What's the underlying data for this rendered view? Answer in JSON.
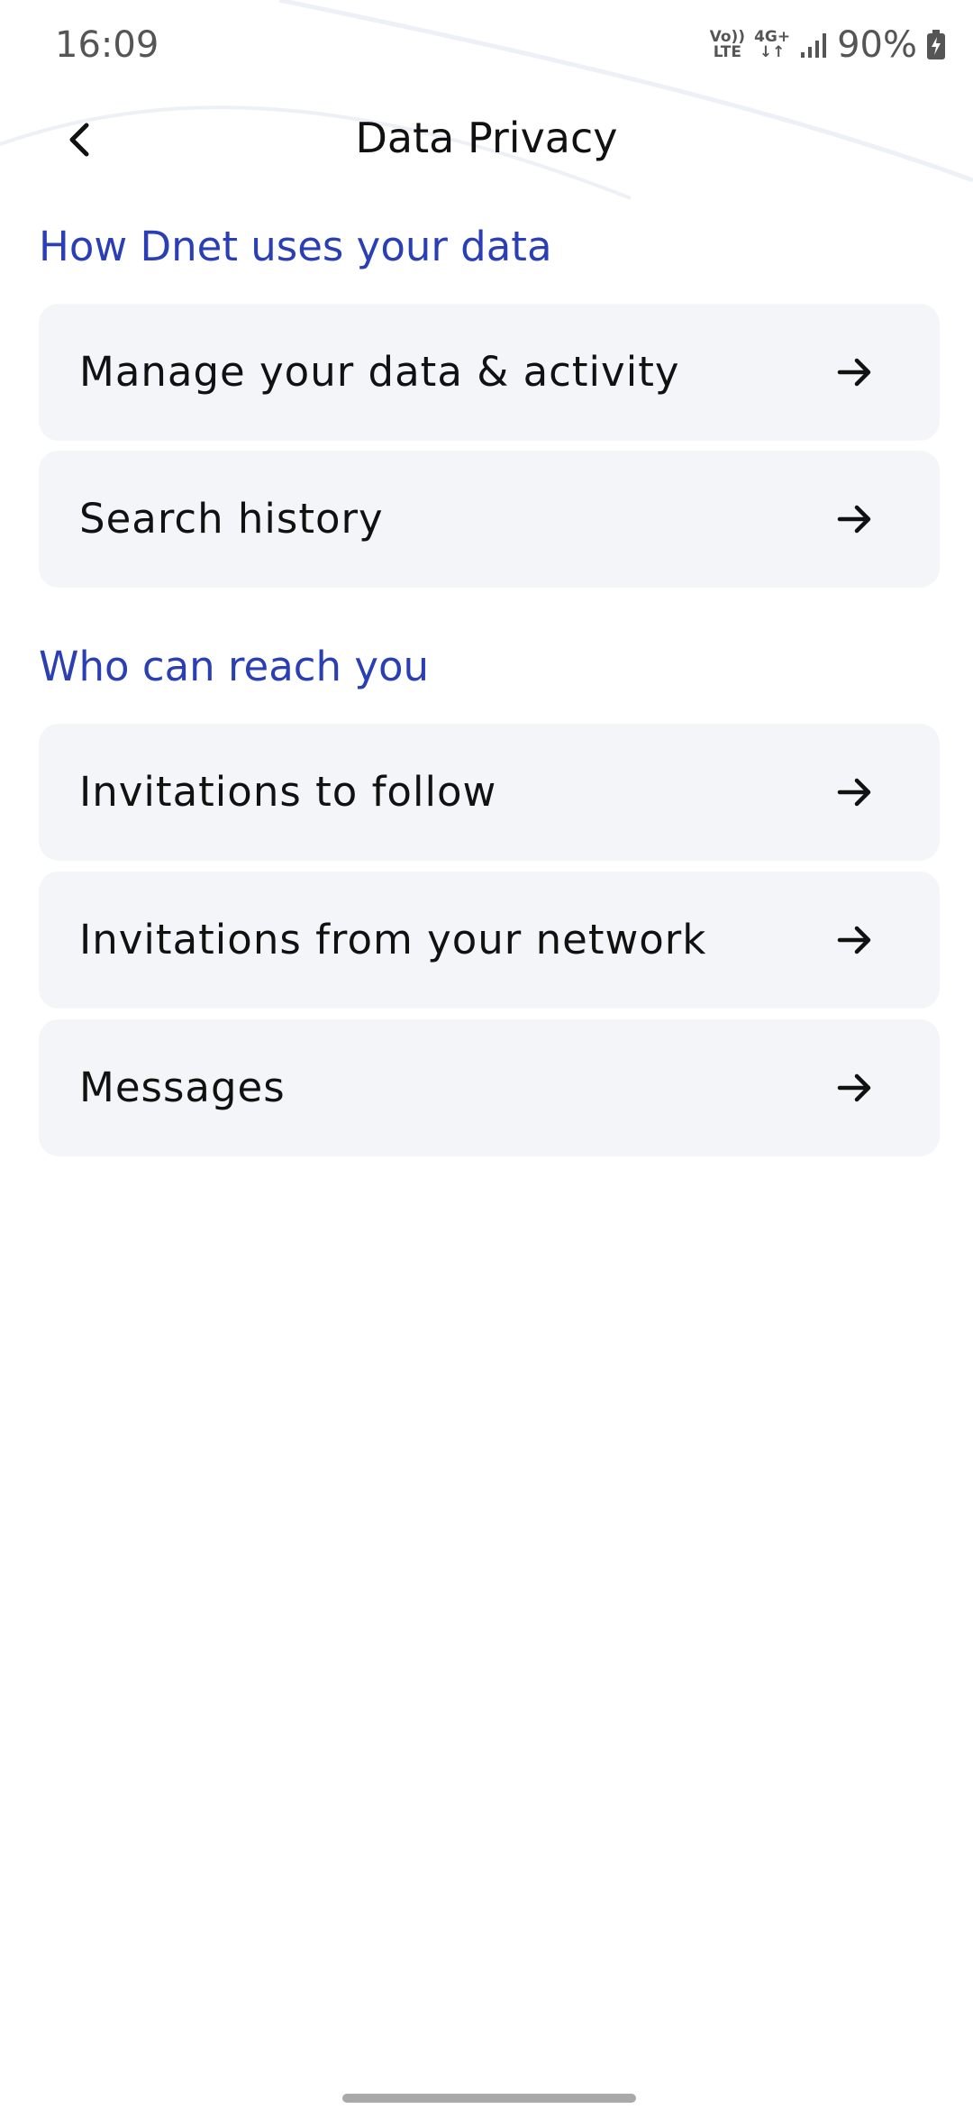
{
  "status_bar": {
    "time": "16:09",
    "volte_top": "Vo))",
    "volte_bottom": "LTE",
    "net_top": "4G+",
    "net_bottom": "↓↑",
    "battery": "90%"
  },
  "header": {
    "title": "Data Privacy"
  },
  "sections": [
    {
      "heading": "How Dnet uses your data",
      "items": [
        {
          "label": "Manage your data & activity"
        },
        {
          "label": "Search history"
        }
      ]
    },
    {
      "heading": "Who can reach you",
      "items": [
        {
          "label": "Invitations to follow"
        },
        {
          "label": "Invitations from your network"
        },
        {
          "label": "Messages"
        }
      ]
    }
  ],
  "colors": {
    "section_heading": "#2a3fb5",
    "card_background": "#f4f5f9"
  },
  "icons": {
    "back": "chevron-left-icon",
    "item_arrow": "arrow-right-icon"
  }
}
